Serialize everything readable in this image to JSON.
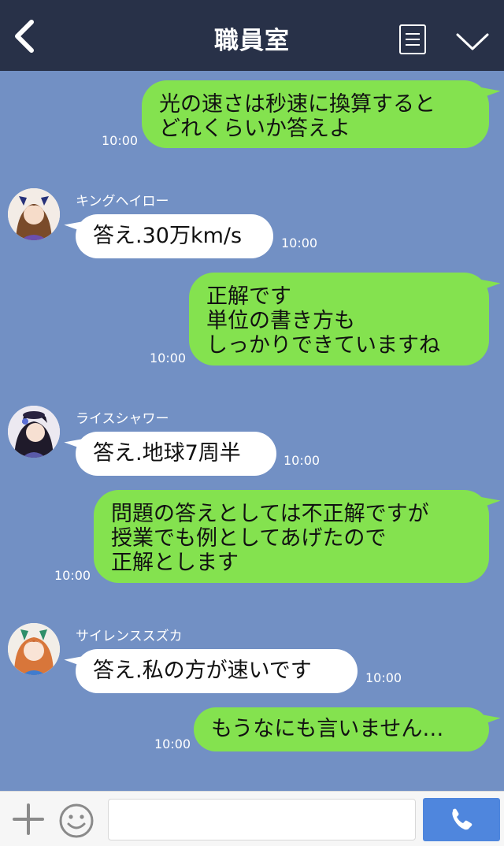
{
  "header": {
    "title": "職員室"
  },
  "messages": [
    {
      "from": "me",
      "lines": [
        "光の速さは秒速に換算すると",
        "どれくらいか答えよ"
      ],
      "time": "10:00"
    },
    {
      "from": "them",
      "sender": "キングヘイロー",
      "lines": [
        "答え.30万km/s"
      ],
      "time": "10:00"
    },
    {
      "from": "me",
      "lines": [
        "正解です",
        "単位の書き方も",
        "しっかりできていますね"
      ],
      "time": "10:00"
    },
    {
      "from": "them",
      "sender": "ライスシャワー",
      "lines": [
        "答え.地球7周半"
      ],
      "time": "10:00"
    },
    {
      "from": "me",
      "lines": [
        "問題の答えとしては不正解ですが",
        "授業でも例としてあげたので",
        "正解とします"
      ],
      "time": "10:00"
    },
    {
      "from": "them",
      "sender": "サイレンススズカ",
      "lines": [
        "答え.私の方が速いです"
      ],
      "time": "10:00"
    },
    {
      "from": "me",
      "lines": [
        "もうなにも言いません…"
      ],
      "time": "10:00"
    }
  ],
  "composer": {
    "placeholder": ""
  },
  "colors": {
    "header": "#283148",
    "background": "#7290c4",
    "my_bubble": "#84e24f",
    "their_bubble": "#ffffff",
    "send": "#4f86dd"
  }
}
